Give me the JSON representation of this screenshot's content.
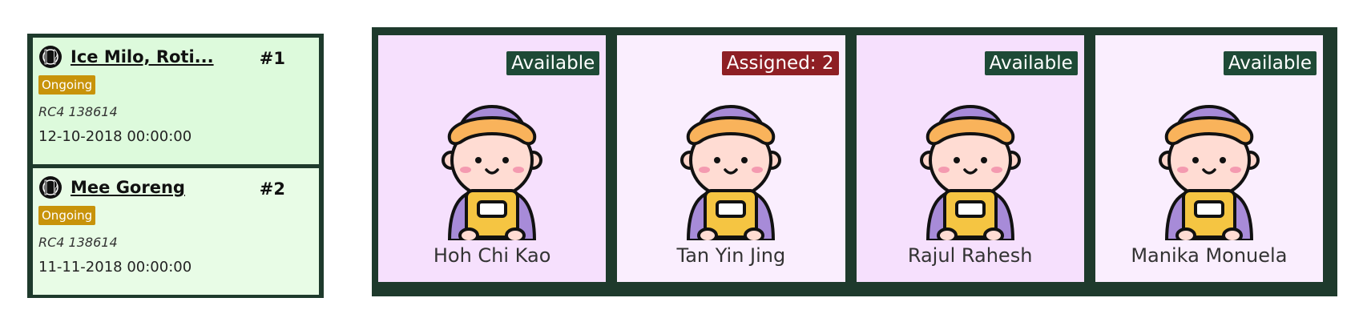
{
  "orders": [
    {
      "number": "#1",
      "name": "Ice Milo, Roti...",
      "status": "Ongoing",
      "address": "RC4 138614",
      "datetime": "12-10-2018 00:00:00",
      "icon": "food-icon"
    },
    {
      "number": "#2",
      "name": "Mee Goreng",
      "status": "Ongoing",
      "address": "RC4 138614",
      "datetime": "11-11-2018 00:00:00",
      "icon": "food-icon"
    }
  ],
  "drivers": [
    {
      "name": "Hoh Chi Kao",
      "status": "Available",
      "status_type": "available",
      "avatar": "delivery-person-icon"
    },
    {
      "name": "Tan Yin Jing",
      "status": "Assigned: 2",
      "status_type": "assigned",
      "avatar": "delivery-person-icon"
    },
    {
      "name": "Rajul Rahesh",
      "status": "Available",
      "status_type": "available",
      "avatar": "delivery-person-icon"
    },
    {
      "name": "Manika Monuela",
      "status": "Available",
      "status_type": "available",
      "avatar": "delivery-person-icon"
    }
  ],
  "colors": {
    "panel_border": "#1e3a2c",
    "ongoing_badge": "#c8930a",
    "available_badge": "#1e4a36",
    "assigned_badge": "#8e1f24"
  }
}
